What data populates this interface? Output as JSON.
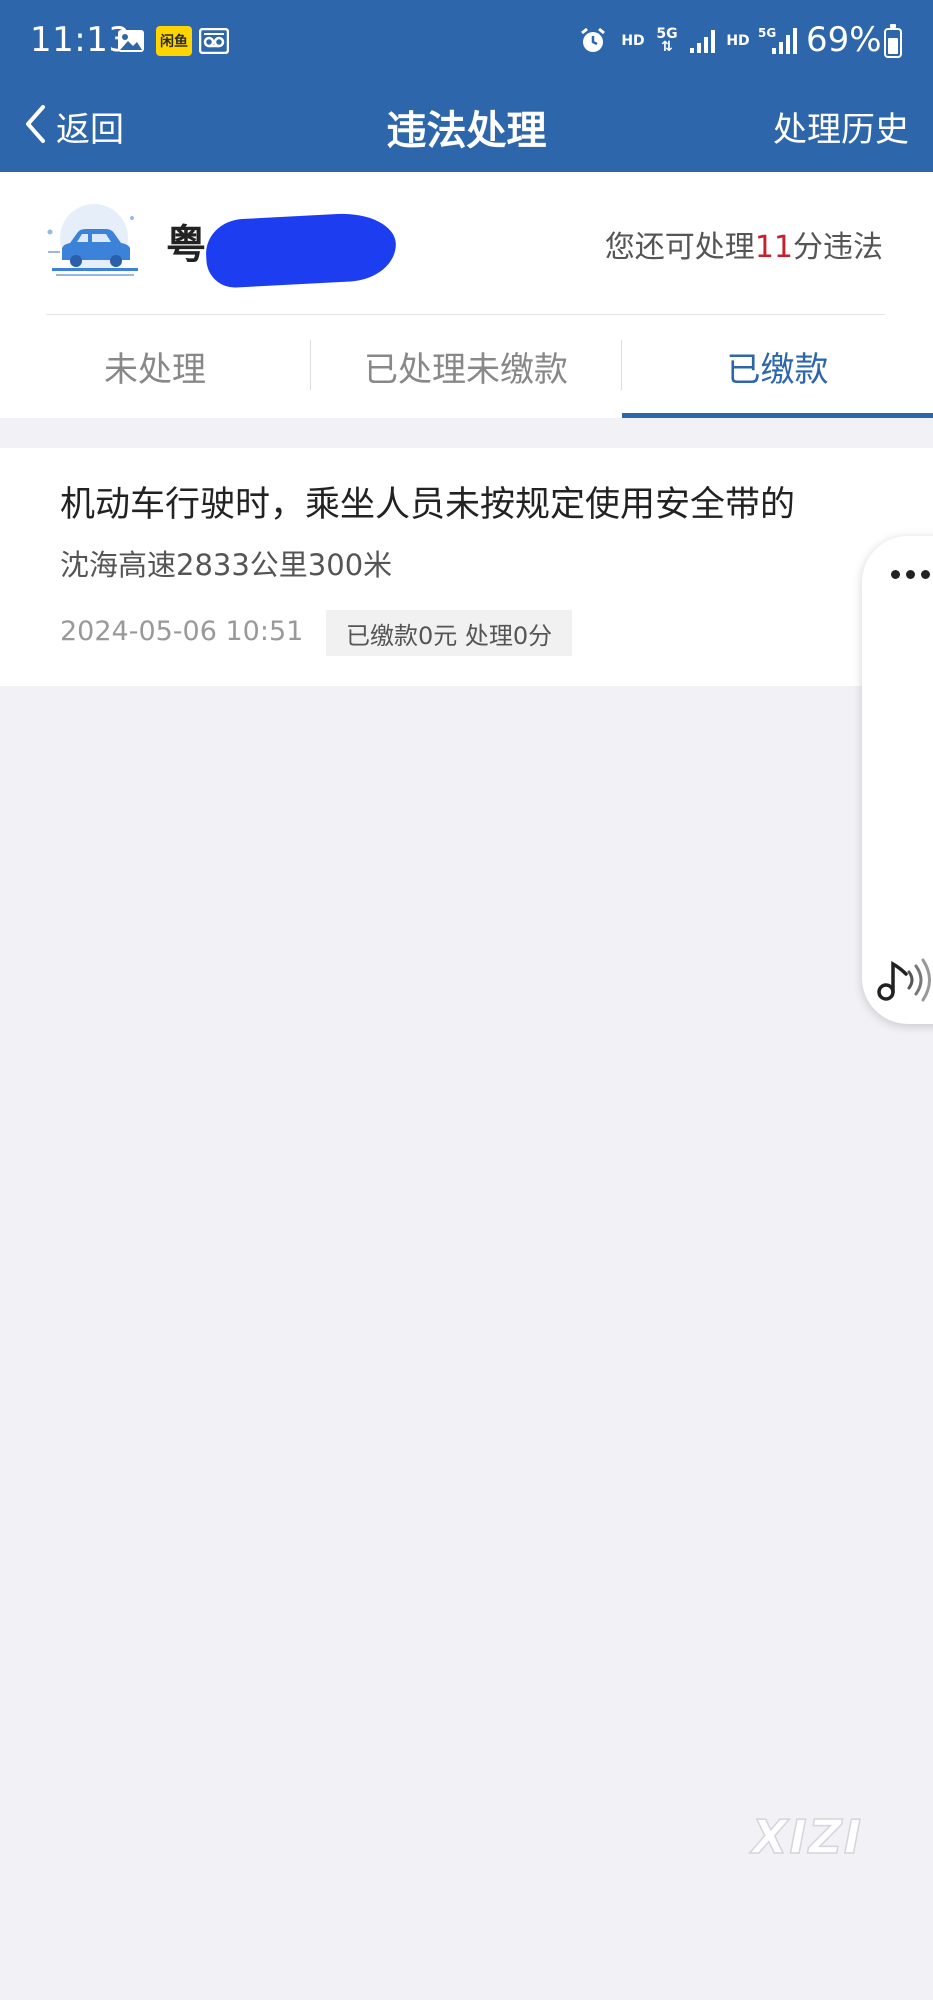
{
  "status_bar": {
    "time": "11:13",
    "app_badge": "闲鱼",
    "hd1": "HD",
    "net1": "5G",
    "hd2": "HD",
    "net2": "5G",
    "battery": "69%"
  },
  "nav": {
    "back_label": "返回",
    "title": "违法处理",
    "history_label": "处理历史"
  },
  "vehicle": {
    "plate_prefix": "粤",
    "remain_prefix": "您还可处理",
    "remain_points": "11",
    "remain_suffix": "分违法"
  },
  "tabs": [
    {
      "label": "未处理",
      "active": false
    },
    {
      "label": "已处理未缴款",
      "active": false
    },
    {
      "label": "已缴款",
      "active": true
    }
  ],
  "violations": [
    {
      "title": "机动车行驶时，乘坐人员未按规定使用安全带的",
      "location": "沈海高速2833公里300米",
      "time": "2024-05-06 10:51",
      "badge": "已缴款0元 处理0分"
    }
  ],
  "watermark": "XIZI",
  "colors": {
    "primary": "#2d66aa",
    "highlight": "#c8202a",
    "background": "#f2f2f6"
  }
}
